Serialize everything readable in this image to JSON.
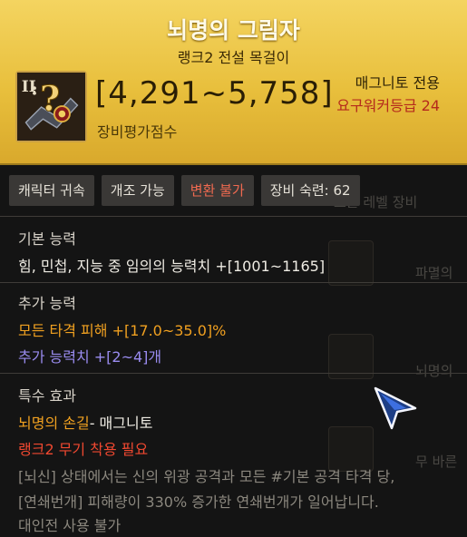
{
  "header": {
    "title": "뇌명의 그림자",
    "subtitle": "랭크2 전설 목걸이",
    "score": "[4,291~5,758]",
    "score_label": "장비평가점수",
    "class_tag": "매그니토 전용",
    "requirement": "요구워커등급 24",
    "icon": "necklace-icon",
    "icon_rank": "II"
  },
  "tags": [
    "캐릭터 귀속",
    "개조 가능",
    "변환 불가",
    "장비 숙련: 62"
  ],
  "basic": {
    "title": "기본 능력",
    "lines": [
      "힘, 민첩, 지능 중 임의의 능력치 +[1001~1165]"
    ]
  },
  "extra": {
    "title": "추가 능력",
    "lines": [
      "모든 타격 피해  +[17.0~35.0]%",
      "추가 능력치 +[2~4]개"
    ]
  },
  "special": {
    "title": "특수 효과",
    "skill_name": "뇌명의 손길",
    "skill_suffix": "- 매그니토",
    "requirement": "랭크2 무기 착용 필요",
    "desc": [
      "[뇌신] 상태에서는 신의 위광 공격과 모든 #기본 공격 타격 당,",
      "[연쇄번개] 피해량이 330% 증가한 연쇄번개가 일어납니다.",
      "대인전 사용 불가"
    ]
  },
  "background_list": {
    "items": [
      "모든 레벨 장비",
      "파멸의",
      "뇌명의",
      "무 바른"
    ]
  },
  "colors": {
    "header": "#e8bf3c",
    "orange": "#f0a020",
    "purple": "#9a8cf0",
    "red": "#f04830"
  }
}
